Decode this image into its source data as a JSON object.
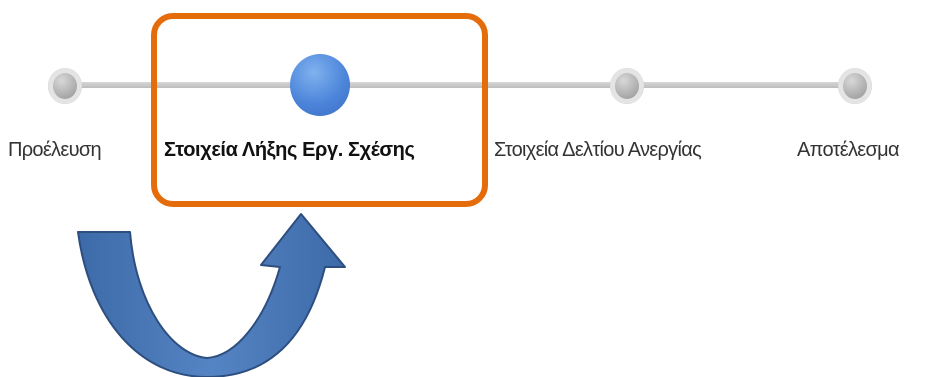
{
  "stepper": {
    "steps": [
      {
        "label": "Προέλευση",
        "state": "inactive"
      },
      {
        "label": "Στοιχεία Λήξης Εργ. Σχέσης",
        "state": "active"
      },
      {
        "label": "Στοιχεία Δελτίου Ανεργίας",
        "state": "inactive"
      },
      {
        "label": "Αποτέλεσμα",
        "state": "inactive"
      }
    ]
  },
  "colors": {
    "active_node": "#4d85da",
    "inactive_node": "#a8a8a8",
    "track": "#cfcfcf",
    "highlight_border": "#e46c0a",
    "arrow_fill": "#4a78b8",
    "arrow_outline": "#2d4e7e"
  },
  "annotations": {
    "highlight": "orange-rounded-box",
    "arrow": "curved-u-turn-arrow"
  }
}
